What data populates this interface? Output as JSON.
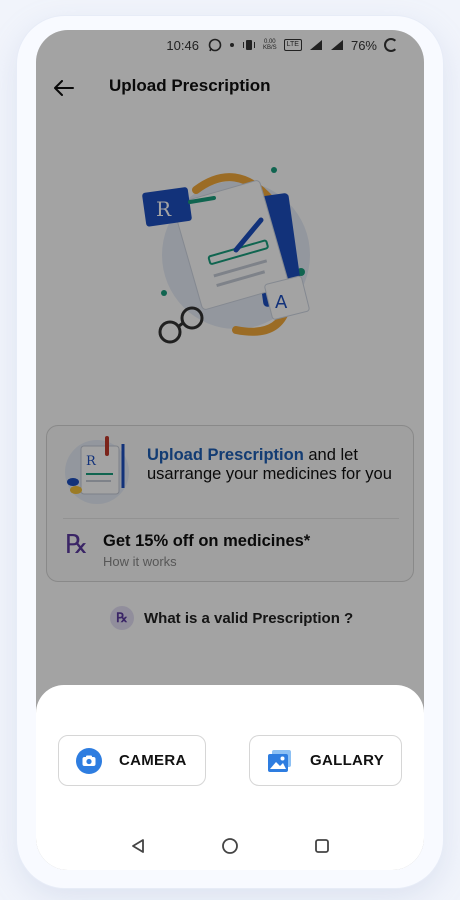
{
  "status_bar": {
    "time": "10:46",
    "data_speed_value": "0.00",
    "data_speed_unit": "KB/S",
    "network": "LTE",
    "battery": "76%"
  },
  "header": {
    "title": "Upload Prescription",
    "back_icon": "arrow-left-icon"
  },
  "hero": {
    "icon": "prescription-illustration"
  },
  "info_card": {
    "highlight": "Upload Prescription",
    "description": " and let usarrange your medicines for you",
    "offer_title": "Get 15% off on medicines*",
    "offer_link": "How it works",
    "rx_symbol": "℞"
  },
  "valid_prescription": {
    "badge": "℞",
    "label": "What is a valid Prescription ?"
  },
  "sheet": {
    "camera_label": "CAMERA",
    "gallery_label": "GALLARY",
    "camera_icon": "camera-icon",
    "gallery_icon": "gallery-icon"
  },
  "colors": {
    "accent": "#1e5fb4",
    "rx_purple": "#5b3aa0",
    "camera_blue": "#2e7de0"
  }
}
